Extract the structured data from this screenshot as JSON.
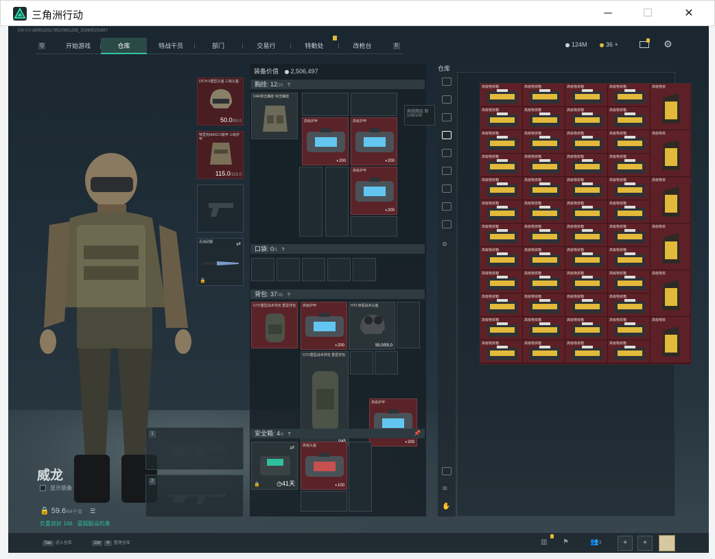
{
  "window": {
    "title": "三角洲行动",
    "minimize": "─",
    "maximize": "☐",
    "close": "✕"
  },
  "session_id": "CN 0:0:1808119117952/0851238_20260515165?",
  "nav": {
    "key_left": "Q",
    "key_right": "E",
    "tabs": [
      "开始游戏",
      "仓库",
      "特战干员",
      "部门",
      "交易行",
      "特勤处",
      "改枪台"
    ],
    "active": "仓库"
  },
  "top_stats": {
    "currency1": "124M",
    "currency2": "36",
    "plus": "+"
  },
  "agent": {
    "name": "威龙",
    "show_equipment": "显示装备"
  },
  "weight": {
    "value": "59.6",
    "max": "/84千克"
  },
  "status_line": "负重良好 166 · 蓝狐骰设的来",
  "equip": {
    "helmet": {
      "label": "DICH-9重型头盔 三级头盔",
      "value": "50.0",
      "max": "/50.0"
    },
    "armor": {
      "label": "特里克MAS2.0装甲 三级护甲",
      "value": "115.0",
      "max": "/115.0"
    },
    "melee_label": "近战武器",
    "weapon1_key": "1",
    "weapon2_key": "2"
  },
  "inventory": {
    "value_label": "装备价值",
    "value": "2,506,497",
    "chest": {
      "label": "胸挂:",
      "count": "12",
      "max": "/24",
      "rig_label": "DAR突击胸挂 突击胸挂",
      "tooltip_name": "高级胸挂 耐",
      "tooltip_value": "108/108",
      "items": [
        {
          "name": "高级护甲",
          "value": "200"
        },
        {
          "name": "高级护甲",
          "value": "200"
        },
        {
          "name": "高级护甲",
          "value": "200"
        }
      ]
    },
    "pocket": {
      "label": "口袋:",
      "count": "0",
      "max": "/5"
    },
    "backpack": {
      "label": "背包:",
      "count": "37",
      "max": "/45",
      "bag_label": "GTO重型战术背包 重型背包",
      "items": [
        {
          "name": "高级护甲",
          "value": "200"
        },
        {
          "name": "H70 夜视战术头盔",
          "value": "55.0",
          "max": "/55.0"
        },
        {
          "name": "GTO重型战术背包 重型背包",
          "value": "45"
        },
        {
          "name": "高级护甲",
          "value": "200"
        }
      ]
    },
    "safe": {
      "label": "安全箱:",
      "count": "4",
      "max": "/6",
      "days": "41天",
      "items": [
        {
          "name": "高级头盔",
          "value": "100"
        }
      ]
    }
  },
  "warehouse": {
    "title": "仓库",
    "cell_label": "高级物资箱",
    "cols": 4,
    "rows": 12,
    "side_label": "高级物资"
  },
  "bottom": {
    "hint1_key": "Tab",
    "hint1": "进入仓库",
    "hint2_key": "Ctrl",
    "hint2_key2": "R",
    "hint2": "整理仓库",
    "players": "3",
    "plus": "+"
  },
  "colors": {
    "accent": "#33c3a4",
    "item_bg": "#5a2328",
    "warehouse_bg": "#5c2026",
    "gold": "#e2b93b"
  }
}
